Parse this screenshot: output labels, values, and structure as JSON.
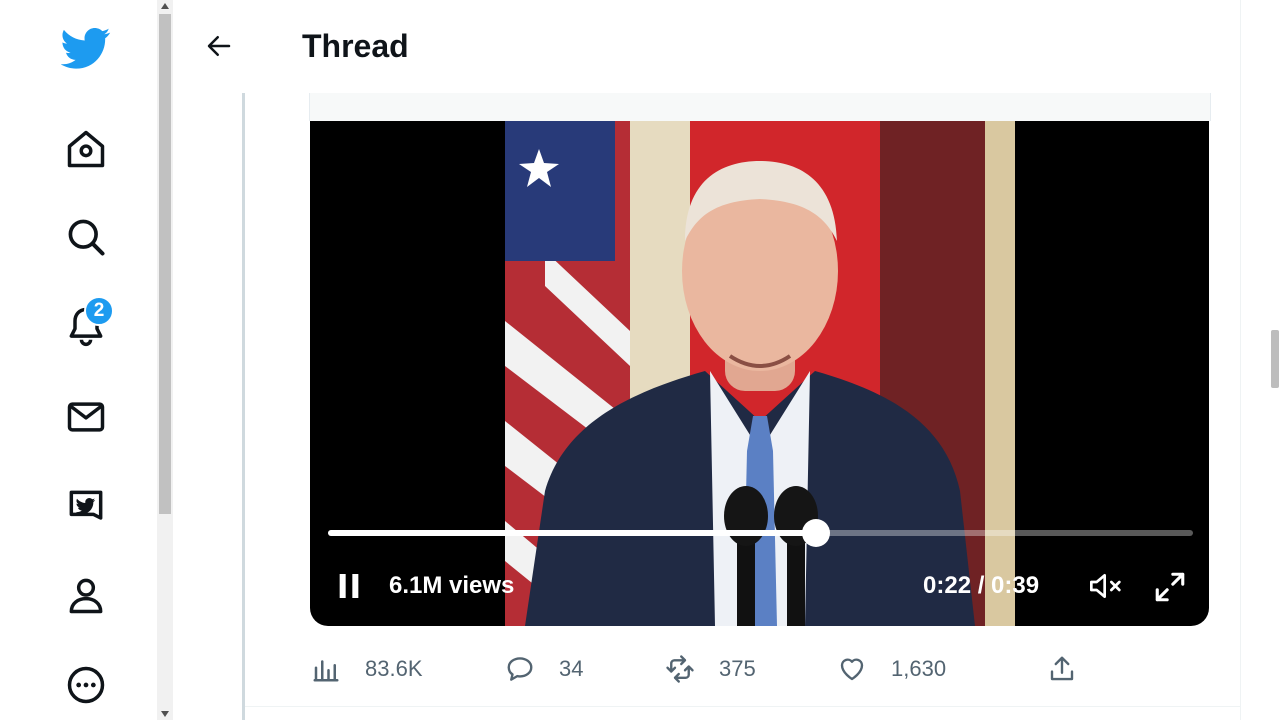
{
  "window": {
    "accent_color": "#1d9bf0"
  },
  "sidebar": {
    "items": [
      {
        "name": "twitter-logo",
        "icon": "twitter-bird-icon"
      },
      {
        "name": "home",
        "icon": "home-icon"
      },
      {
        "name": "explore",
        "icon": "search-icon"
      },
      {
        "name": "notifications",
        "icon": "bell-icon",
        "badge": "2"
      },
      {
        "name": "messages",
        "icon": "mail-icon"
      },
      {
        "name": "twitter-blue",
        "icon": "twitter-blue-icon"
      },
      {
        "name": "profile",
        "icon": "person-icon"
      },
      {
        "name": "more",
        "icon": "more-circle-icon"
      }
    ]
  },
  "header": {
    "title": "Thread",
    "back_icon": "back-arrow-icon"
  },
  "video": {
    "views": "6.1M views",
    "time": "0:22 / 0:39",
    "progress_fraction": 0.564,
    "state": "playing",
    "muted": true
  },
  "tweet": {
    "actions": [
      {
        "name": "views",
        "icon": "analytics-icon",
        "count": "83.6K"
      },
      {
        "name": "reply",
        "icon": "reply-icon",
        "count": "34"
      },
      {
        "name": "retweet",
        "icon": "retweet-icon",
        "count": "375"
      },
      {
        "name": "like",
        "icon": "heart-icon",
        "count": "1,630"
      },
      {
        "name": "share",
        "icon": "share-icon",
        "count": ""
      }
    ]
  }
}
